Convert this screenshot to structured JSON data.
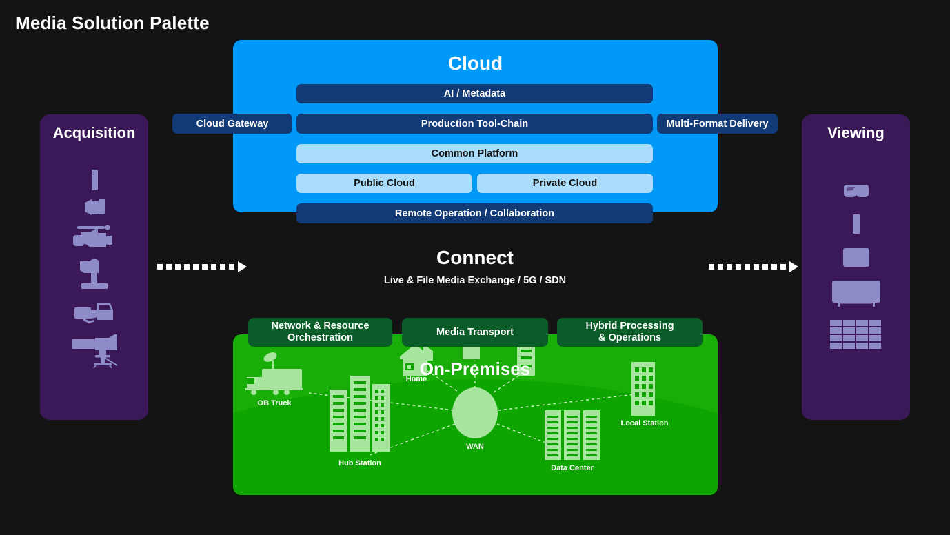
{
  "page": {
    "title": "Media Solution Palette",
    "background_color": "#141414"
  },
  "colors": {
    "cloud_blue": "#0099f7",
    "navy": "#123a76",
    "light_blue": "#aadcfb",
    "purple": "#3b1857",
    "purple_icon": "#8e8cc8",
    "green": "#19ad07",
    "dark_green": "#0a5c28",
    "green_icon": "#a8e6a0",
    "white": "#ffffff"
  },
  "acquisition": {
    "title": "Acquisition",
    "icons": [
      {
        "name": "smartphone-icon"
      },
      {
        "name": "action-camera-icon"
      },
      {
        "name": "camcorder-icon"
      },
      {
        "name": "studio-camera-pedestal-icon"
      },
      {
        "name": "shoulder-camera-icon"
      },
      {
        "name": "tripod-studio-camera-icon"
      }
    ]
  },
  "viewing": {
    "title": "Viewing",
    "icons": [
      {
        "name": "vr-headset-icon"
      },
      {
        "name": "smartphone-icon"
      },
      {
        "name": "tablet-icon"
      },
      {
        "name": "television-icon"
      },
      {
        "name": "video-wall-icon"
      }
    ]
  },
  "cloud": {
    "title": "Cloud",
    "left_chip": "Cloud Gateway",
    "right_chip": "Multi-Format Delivery",
    "bars": {
      "ai_metadata": "AI / Metadata",
      "production_tool_chain": "Production Tool-Chain",
      "common_platform": "Common Platform",
      "public_cloud": "Public Cloud",
      "private_cloud": "Private Cloud",
      "remote_operation": "Remote Operation / Collaboration"
    }
  },
  "connect": {
    "title": "Connect",
    "subtitle": "Live & File Media Exchange / 5G / SDN",
    "left_arrow_name": "arrow-acquisition-to-core",
    "right_arrow_name": "arrow-core-to-viewing"
  },
  "onpremises": {
    "title": "On-Premises",
    "chips": [
      "Network & Resource Orchestration",
      "Media Transport",
      "Hybrid Processing & Operations"
    ],
    "chip_lines": {
      "orchestration_line1": "Network & Resource",
      "orchestration_line2": "Orchestration",
      "transport_line1": "Media Transport",
      "hybrid_line1": "Hybrid Processing",
      "hybrid_line2": "& Operations"
    },
    "nodes": [
      {
        "name": "ob-truck-node",
        "label": "OB Truck"
      },
      {
        "name": "hub-station-node",
        "label": "Hub Station"
      },
      {
        "name": "home-node",
        "label": "Home"
      },
      {
        "name": "wan-node",
        "label": "WAN"
      },
      {
        "name": "data-center-node",
        "label": "Data Center"
      },
      {
        "name": "local-station-node",
        "label": "Local Station"
      }
    ]
  }
}
